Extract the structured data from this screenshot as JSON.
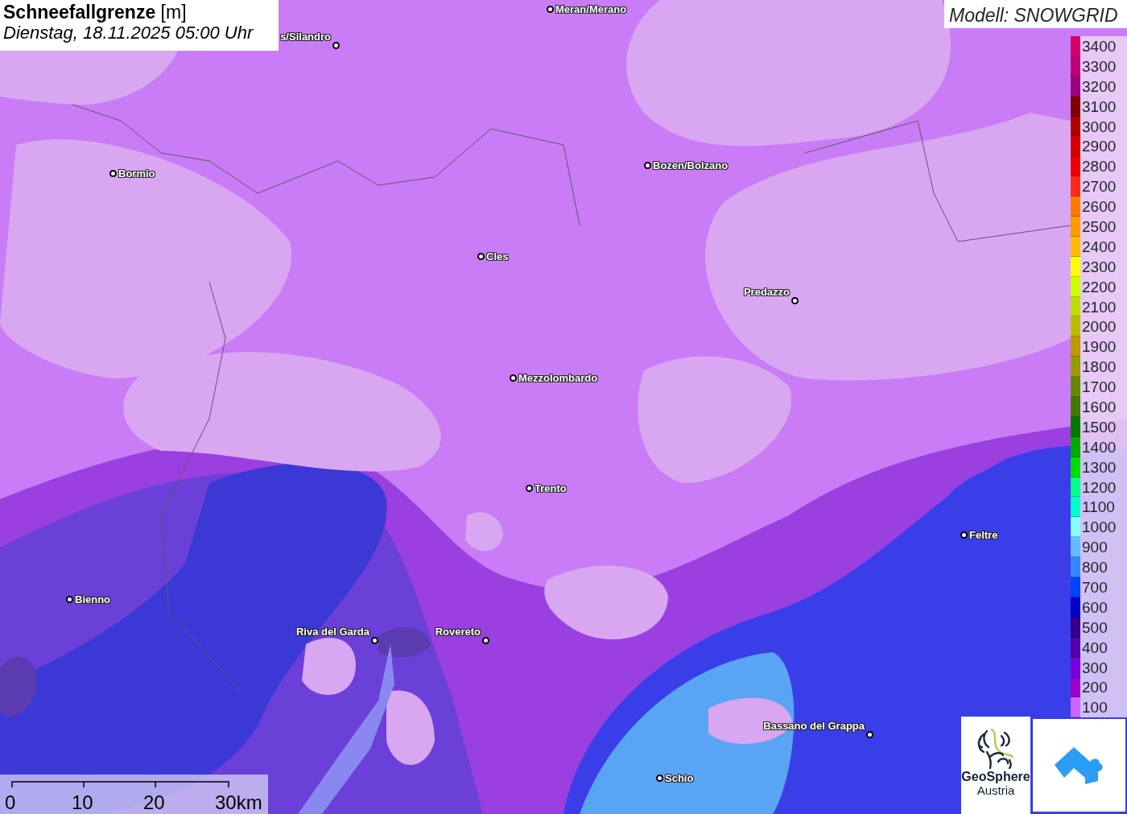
{
  "title": {
    "heading": "**Schneefallgrenze** [m]",
    "datetime": "Dienstag, 18.11.2025 05:00 Uhr"
  },
  "model": "Modell: SNOWGRID",
  "legend": [
    {
      "label": "3400",
      "color": "#d1006b"
    },
    {
      "label": "3300",
      "color": "#bf007a"
    },
    {
      "label": "3200",
      "color": "#9c007f"
    },
    {
      "label": "3100",
      "color": "#800000"
    },
    {
      "label": "3000",
      "color": "#b00000"
    },
    {
      "label": "2900",
      "color": "#d40000"
    },
    {
      "label": "2800",
      "color": "#ee0000"
    },
    {
      "label": "2700",
      "color": "#ff2a1a"
    },
    {
      "label": "2600",
      "color": "#ff7a00"
    },
    {
      "label": "2500",
      "color": "#ff9a00"
    },
    {
      "label": "2400",
      "color": "#ffbb00"
    },
    {
      "label": "2300",
      "color": "#ffff00"
    },
    {
      "label": "2200",
      "color": "#ccff00"
    },
    {
      "label": "2100",
      "color": "#bbdd00"
    },
    {
      "label": "2000",
      "color": "#bbbb00"
    },
    {
      "label": "1900",
      "color": "#bb9900"
    },
    {
      "label": "1800",
      "color": "#999900"
    },
    {
      "label": "1700",
      "color": "#668800"
    },
    {
      "label": "1600",
      "color": "#447700"
    },
    {
      "label": "1500",
      "color": "#007700"
    },
    {
      "label": "1400",
      "color": "#00aa00"
    },
    {
      "label": "1300",
      "color": "#00dd00"
    },
    {
      "label": "1200",
      "color": "#00ff88"
    },
    {
      "label": "1100",
      "color": "#00ffcc"
    },
    {
      "label": "1000",
      "color": "#88ffff"
    },
    {
      "label": "900",
      "color": "#66bbff"
    },
    {
      "label": "800",
      "color": "#3388ff"
    },
    {
      "label": "700",
      "color": "#0044ff"
    },
    {
      "label": "600",
      "color": "#0000cc"
    },
    {
      "label": "500",
      "color": "#330088"
    },
    {
      "label": "400",
      "color": "#5500aa"
    },
    {
      "label": "300",
      "color": "#7700dd"
    },
    {
      "label": "200",
      "color": "#9900cc"
    },
    {
      "label": "100",
      "color": "#cc66ff"
    }
  ],
  "places": [
    {
      "name": "Meran/Merano"
    },
    {
      "name": "s/Silandro"
    },
    {
      "name": "Bormio"
    },
    {
      "name": "Bozen/Bolzano"
    },
    {
      "name": "Cles"
    },
    {
      "name": "Predazzo"
    },
    {
      "name": "Mezzolombardo"
    },
    {
      "name": "Trento"
    },
    {
      "name": "Feltre"
    },
    {
      "name": "Bienno"
    },
    {
      "name": "Riva del Garda"
    },
    {
      "name": "Rovereto"
    },
    {
      "name": "Bassano del Grappa"
    },
    {
      "name": "Schio"
    }
  ],
  "scale": [
    "0",
    "10",
    "20",
    "30km"
  ],
  "logo": {
    "name": "GeoSphere",
    "subtitle": "Austria"
  }
}
